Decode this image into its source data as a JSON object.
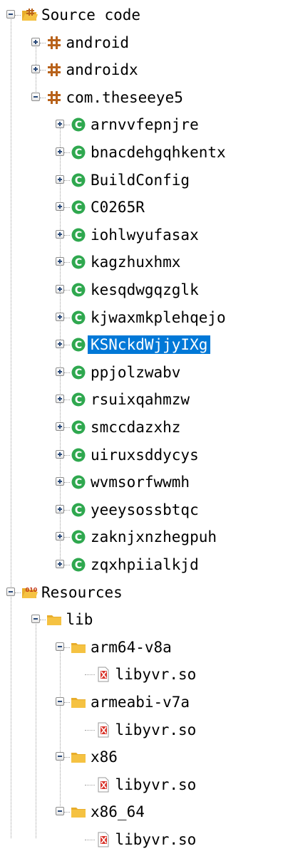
{
  "tree": [
    {
      "label": "Source code",
      "depth": 0,
      "kind": "source-folder",
      "expander": "minus",
      "icon": "source-folder-icon"
    },
    {
      "label": "android",
      "depth": 1,
      "kind": "package",
      "expander": "plus",
      "icon": "package-icon"
    },
    {
      "label": "androidx",
      "depth": 1,
      "kind": "package",
      "expander": "plus",
      "icon": "package-icon"
    },
    {
      "label": "com.theseeye5",
      "depth": 1,
      "kind": "package",
      "expander": "minus",
      "icon": "package-icon"
    },
    {
      "label": "arnvvfepnjre",
      "depth": 2,
      "kind": "class",
      "expander": "plus",
      "icon": "class-icon"
    },
    {
      "label": "bnacdehgqhkentx",
      "depth": 2,
      "kind": "class",
      "expander": "plus",
      "icon": "class-icon"
    },
    {
      "label": "BuildConfig",
      "depth": 2,
      "kind": "class",
      "expander": "plus",
      "icon": "class-icon"
    },
    {
      "label": "C0265R",
      "depth": 2,
      "kind": "class",
      "expander": "plus",
      "icon": "class-icon"
    },
    {
      "label": "iohlwyufasax",
      "depth": 2,
      "kind": "class",
      "expander": "plus",
      "icon": "class-icon"
    },
    {
      "label": "kagzhuxhmx",
      "depth": 2,
      "kind": "class",
      "expander": "plus",
      "icon": "class-icon"
    },
    {
      "label": "kesqdwgqzglk",
      "depth": 2,
      "kind": "class",
      "expander": "plus",
      "icon": "class-icon"
    },
    {
      "label": "kjwaxmkplehqejo",
      "depth": 2,
      "kind": "class",
      "expander": "plus",
      "icon": "class-icon"
    },
    {
      "label": "KSNckdWjjyIXg",
      "depth": 2,
      "kind": "class",
      "expander": "plus",
      "icon": "class-icon",
      "selected": true
    },
    {
      "label": "ppjolzwabv",
      "depth": 2,
      "kind": "class",
      "expander": "plus",
      "icon": "class-icon"
    },
    {
      "label": "rsuixqahmzw",
      "depth": 2,
      "kind": "class",
      "expander": "plus",
      "icon": "class-icon"
    },
    {
      "label": "smccdazxhz",
      "depth": 2,
      "kind": "class",
      "expander": "plus",
      "icon": "class-icon"
    },
    {
      "label": "uiruxsddycys",
      "depth": 2,
      "kind": "class",
      "expander": "plus",
      "icon": "class-icon"
    },
    {
      "label": "wvmsorfwwmh",
      "depth": 2,
      "kind": "class",
      "expander": "plus",
      "icon": "class-icon"
    },
    {
      "label": "yeeysossbtqc",
      "depth": 2,
      "kind": "class",
      "expander": "plus",
      "icon": "class-icon"
    },
    {
      "label": "zaknjxnzhegpuh",
      "depth": 2,
      "kind": "class",
      "expander": "plus",
      "icon": "class-icon"
    },
    {
      "label": "zqxhpiialkjd",
      "depth": 2,
      "kind": "class",
      "expander": "plus",
      "icon": "class-icon"
    },
    {
      "label": "Resources",
      "depth": 0,
      "kind": "resource-folder",
      "expander": "minus",
      "icon": "resources-folder-icon"
    },
    {
      "label": "lib",
      "depth": 1,
      "kind": "folder",
      "expander": "minus",
      "icon": "folder-icon"
    },
    {
      "label": "arm64-v8a",
      "depth": 2,
      "kind": "folder",
      "expander": "minus",
      "icon": "folder-icon"
    },
    {
      "label": "libyvr.so",
      "depth": 3,
      "kind": "file",
      "expander": "none",
      "icon": "so-file-icon"
    },
    {
      "label": "armeabi-v7a",
      "depth": 2,
      "kind": "folder",
      "expander": "minus",
      "icon": "folder-icon"
    },
    {
      "label": "libyvr.so",
      "depth": 3,
      "kind": "file",
      "expander": "none",
      "icon": "so-file-icon"
    },
    {
      "label": "x86",
      "depth": 2,
      "kind": "folder",
      "expander": "minus",
      "icon": "folder-icon"
    },
    {
      "label": "libyvr.so",
      "depth": 3,
      "kind": "file",
      "expander": "none",
      "icon": "so-file-icon"
    },
    {
      "label": "x86_64",
      "depth": 2,
      "kind": "folder",
      "expander": "minus",
      "icon": "folder-icon"
    },
    {
      "label": "libyvr.so",
      "depth": 3,
      "kind": "file",
      "expander": "none",
      "icon": "so-file-icon"
    }
  ],
  "colors": {
    "selection": "#0078d7",
    "class_icon": "#2fa84f",
    "package_icon": "#b8621b",
    "folder_icon": "#f5c242",
    "so_file_icon": "#d9342b"
  }
}
